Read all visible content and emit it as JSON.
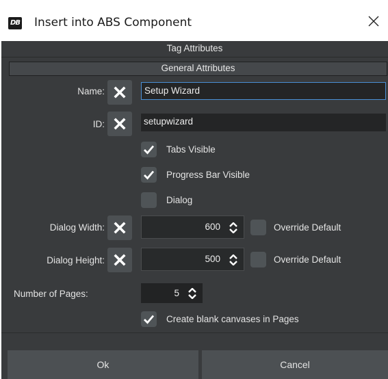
{
  "window": {
    "title": "Insert into ABS Component",
    "icon": "db-logo-icon",
    "close_icon": "close-icon"
  },
  "sections": {
    "tag_attributes": "Tag Attributes",
    "general_attributes": "General Attributes"
  },
  "fields": {
    "name": {
      "label": "Name:",
      "value": "Setup Wizard"
    },
    "id": {
      "label": "ID:",
      "value": "setupwizard"
    }
  },
  "checkboxes": {
    "tabs_visible": {
      "label": "Tabs Visible",
      "checked": true
    },
    "progress_bar_visible": {
      "label": "Progress Bar Visible",
      "checked": true
    },
    "dialog": {
      "label": "Dialog",
      "checked": false
    },
    "create_blank": {
      "label": "Create blank canvases in Pages",
      "checked": true
    }
  },
  "dialog_width": {
    "label": "Dialog Width:",
    "value": "600",
    "override_label": "Override Default",
    "override_checked": false
  },
  "dialog_height": {
    "label": "Dialog Height:",
    "value": "500",
    "override_label": "Override Default",
    "override_checked": false
  },
  "pages": {
    "label": "Number of Pages:",
    "value": "5"
  },
  "buttons": {
    "ok": "Ok",
    "cancel": "Cancel"
  },
  "colors": {
    "background": "#393b3d",
    "accent": "#4a8fd6",
    "button": "#4c5053"
  }
}
